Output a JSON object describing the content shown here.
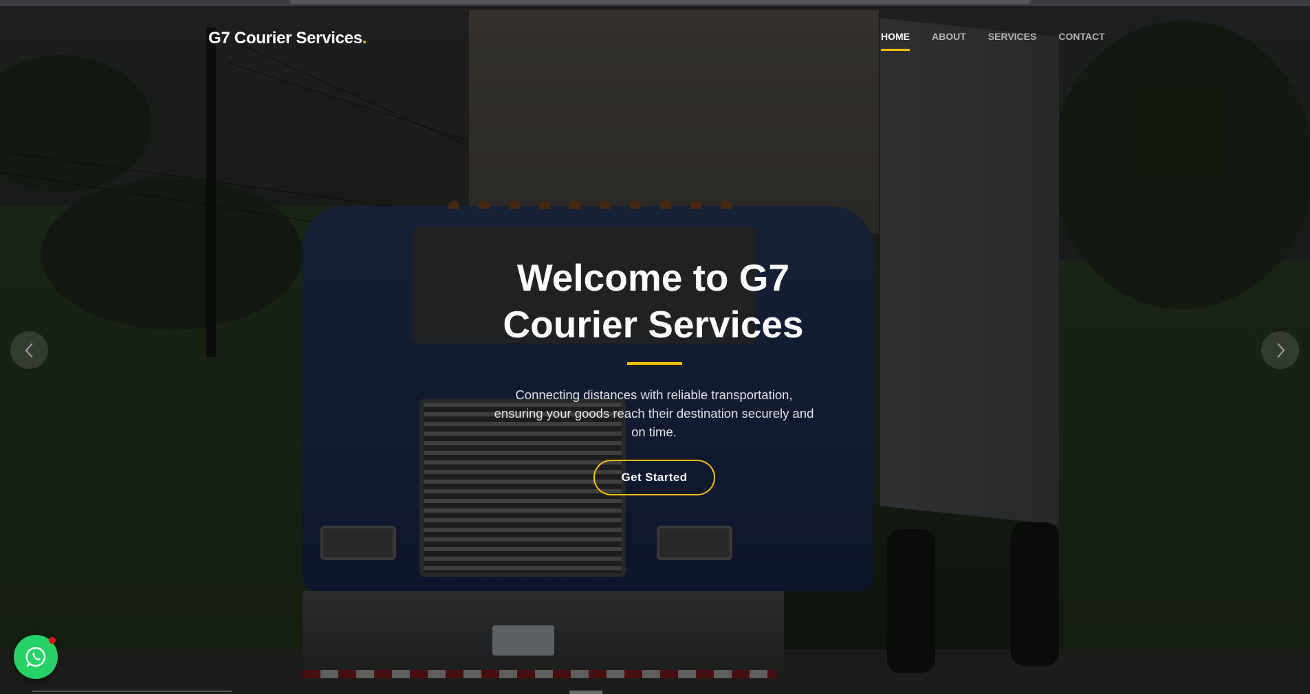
{
  "header": {
    "logo_text": "G7 Courier Services",
    "logo_dot": ".",
    "nav": [
      {
        "label": "HOME",
        "active": true
      },
      {
        "label": "ABOUT",
        "active": false
      },
      {
        "label": "SERVICES",
        "active": false
      },
      {
        "label": "CONTACT",
        "active": false
      }
    ]
  },
  "hero": {
    "title_line1": "Welcome to G7",
    "title_line2": "Courier Services",
    "description": "Connecting distances with reliable transportation, ensuring your goods reach their destination securely and on time.",
    "cta_label": "Get Started"
  },
  "carousel": {
    "prev_icon": "chevron-left-icon",
    "next_icon": "chevron-right-icon"
  },
  "floating": {
    "whatsapp_icon": "whatsapp-icon"
  },
  "colors": {
    "accent": "#ffc107",
    "whatsapp": "#25d366",
    "notification_dot": "#e01010"
  }
}
